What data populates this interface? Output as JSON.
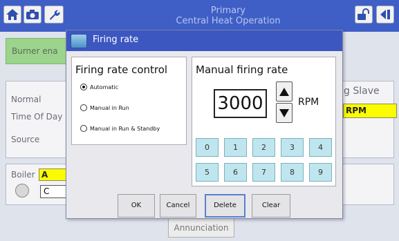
{
  "header": {
    "title_line1": "Primary",
    "title_line2": "Central Heat Operation",
    "home_icon": "home-icon",
    "camera_icon": "camera-icon",
    "wrench_icon": "wrench-icon",
    "unlock_icon": "unlock-icon",
    "back_icon": "back-icon"
  },
  "background": {
    "burner_label": "Burner ena",
    "normal_label": "Normal",
    "time_label": "Time Of Day",
    "source_label": "Source",
    "slave_label": "g Slave",
    "slave_value": "RPM",
    "boiler_label": "Boiler",
    "boiler_value": "A",
    "boiler_box": "C",
    "annunciation_tab": "Annunciation"
  },
  "dialog": {
    "title": "Firing rate",
    "control_group": {
      "title": "Firing rate control",
      "options": [
        "Automatic",
        "Manual in Run",
        "Manual in Run & Standby"
      ],
      "selected": "Automatic"
    },
    "manual_group": {
      "title": "Manual firing rate",
      "value": "3000",
      "unit": "RPM",
      "keys": [
        "0",
        "1",
        "2",
        "3",
        "4",
        "5",
        "6",
        "7",
        "8",
        "9"
      ]
    },
    "buttons": {
      "ok": "OK",
      "cancel": "Cancel",
      "delete": "Delete",
      "clear": "Clear"
    }
  },
  "colors": {
    "header_blue": "#3f5fc6",
    "dialog_title_blue": "#3d57c1",
    "keypad_cyan": "#bfe6ee",
    "highlight_yellow": "#fcfc00",
    "burner_green": "#9cd48d"
  }
}
